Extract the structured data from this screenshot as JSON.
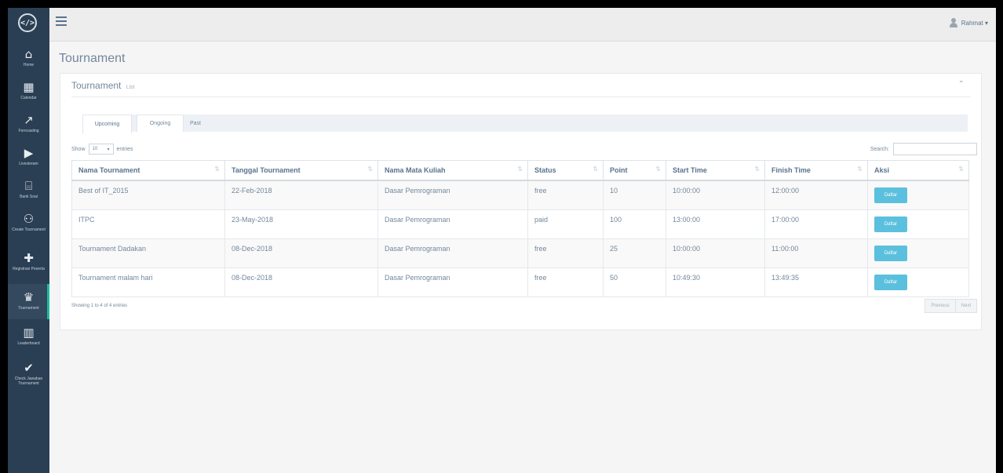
{
  "app": {
    "logo_glyph": "</>",
    "user_name": "Rahmat ▾"
  },
  "sidebar": {
    "items": [
      {
        "label": "Home",
        "icon": "home-icon",
        "glyph": "⌂"
      },
      {
        "label": "Calendar",
        "icon": "calendar-icon",
        "glyph": "▦"
      },
      {
        "label": "Forecasting",
        "icon": "chart-line-icon",
        "glyph": "↗"
      },
      {
        "label": "Livestream",
        "icon": "video-icon",
        "glyph": "▶"
      },
      {
        "label": "Bank Soal",
        "icon": "bank-icon",
        "glyph": "⌸"
      },
      {
        "label": "Create Tournament",
        "icon": "users-icon",
        "glyph": "⚇"
      },
      {
        "label": "Registrasi Peserta",
        "icon": "plus-icon",
        "glyph": "✚"
      },
      {
        "label": "Tournament",
        "icon": "trophy-icon",
        "glyph": "♛"
      },
      {
        "label": "Leaderboard",
        "icon": "bar-chart-icon",
        "glyph": "▥"
      },
      {
        "label": "Check Jawaban Tournament",
        "icon": "check-icon",
        "glyph": "✔"
      }
    ]
  },
  "page": {
    "title": "Tournament"
  },
  "panel": {
    "title": "Tournament",
    "subtitle": "List",
    "collapse_glyph": "⌃"
  },
  "tabs": [
    "Upcoming",
    "Ongoing",
    "Past"
  ],
  "table_controls": {
    "show": "Show",
    "length": "10",
    "entries": "entries",
    "search_label": "Search:"
  },
  "table": {
    "columns": [
      "Nama Tournament",
      "Tanggal Tournament",
      "Nama Mata Kuliah",
      "Status",
      "Point",
      "Start Time",
      "Finish Time",
      "Aksi"
    ],
    "rows": [
      [
        "Best of IT_2015",
        "22-Feb-2018",
        "Dasar Pemrograman",
        "free",
        "10",
        "10:00:00",
        "12:00:00",
        "Daftar"
      ],
      [
        "ITPC",
        "23-May-2018",
        "Dasar Pemrograman",
        "paid",
        "100",
        "13:00:00",
        "17:00:00",
        "Daftar"
      ],
      [
        "Tournament Dadakan",
        "08-Dec-2018",
        "Dasar Pemrograman",
        "free",
        "25",
        "10:00:00",
        "11:00:00",
        "Daftar"
      ],
      [
        "Tournament malam hari",
        "08-Dec-2018",
        "Dasar Pemrograman",
        "free",
        "50",
        "10:49:30",
        "13:49:35",
        "Daftar"
      ]
    ]
  },
  "footer": {
    "info": "Showing 1 to 4 of 4 entries",
    "previous": "Previous",
    "next": "Next"
  },
  "colors": {
    "sidebar": "#2a3f54",
    "accent": "#1abb9c",
    "button": "#5bc0de"
  }
}
